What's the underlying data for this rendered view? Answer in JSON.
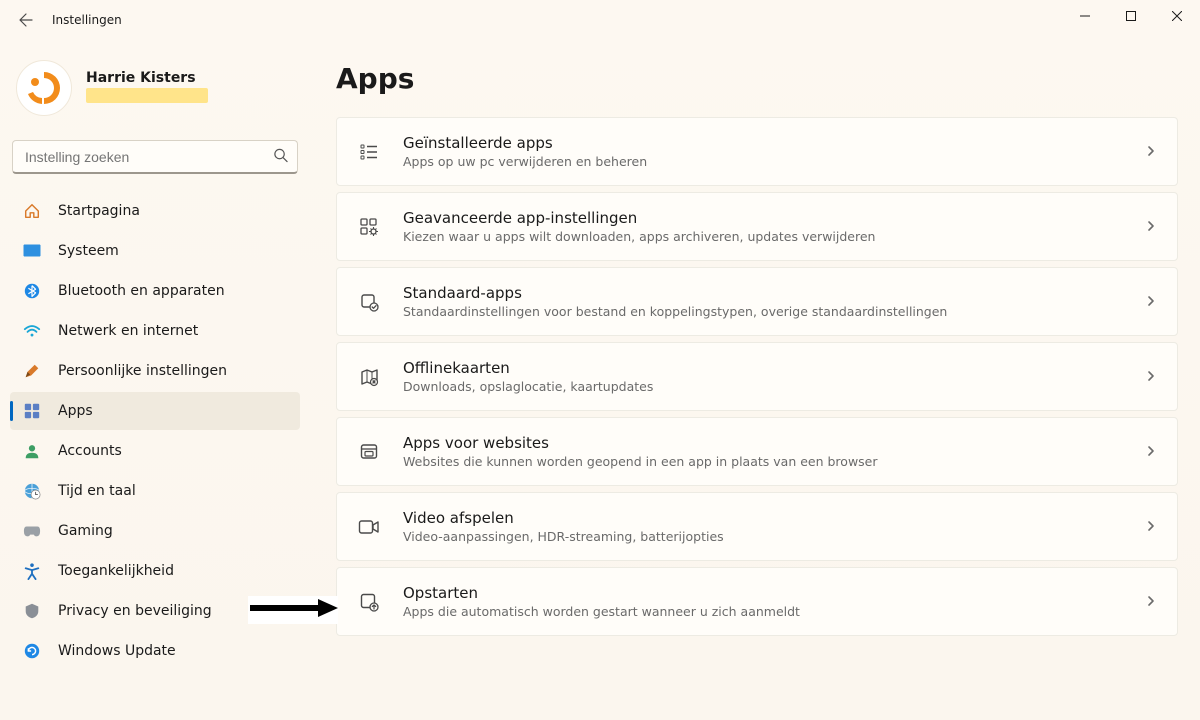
{
  "window": {
    "title": "Instellingen"
  },
  "profile": {
    "name": "Harrie Kisters"
  },
  "search": {
    "placeholder": "Instelling zoeken"
  },
  "sidebar": {
    "items": [
      {
        "id": "home",
        "label": "Startpagina"
      },
      {
        "id": "system",
        "label": "Systeem"
      },
      {
        "id": "bluetooth",
        "label": "Bluetooth en apparaten"
      },
      {
        "id": "network",
        "label": "Netwerk en internet"
      },
      {
        "id": "personal",
        "label": "Persoonlijke instellingen"
      },
      {
        "id": "apps",
        "label": "Apps",
        "active": true
      },
      {
        "id": "accounts",
        "label": "Accounts"
      },
      {
        "id": "time",
        "label": "Tijd en taal"
      },
      {
        "id": "gaming",
        "label": "Gaming"
      },
      {
        "id": "access",
        "label": "Toegankelijkheid"
      },
      {
        "id": "privacy",
        "label": "Privacy en beveiliging"
      },
      {
        "id": "update",
        "label": "Windows Update"
      }
    ]
  },
  "page": {
    "title": "Apps",
    "cards": [
      {
        "id": "installed",
        "title": "Geïnstalleerde apps",
        "desc": "Apps op uw pc verwijderen en beheren"
      },
      {
        "id": "advanced",
        "title": "Geavanceerde app-instellingen",
        "desc": "Kiezen waar u apps wilt downloaden, apps archiveren, updates verwijderen"
      },
      {
        "id": "default",
        "title": "Standaard-apps",
        "desc": "Standaardinstellingen voor bestand en koppelingstypen, overige standaardinstellingen"
      },
      {
        "id": "offline",
        "title": "Offlinekaarten",
        "desc": "Downloads, opslaglocatie, kaartupdates"
      },
      {
        "id": "websites",
        "title": "Apps voor websites",
        "desc": "Websites die kunnen worden geopend in een app in plaats van een browser"
      },
      {
        "id": "video",
        "title": "Video afspelen",
        "desc": "Video-aanpassingen, HDR-streaming, batterijopties"
      },
      {
        "id": "startup",
        "title": "Opstarten",
        "desc": "Apps die automatisch worden gestart wanneer u zich aanmeldt"
      }
    ]
  },
  "colors": {
    "accent": "#0067c0",
    "avatar": "#f28c1b"
  }
}
